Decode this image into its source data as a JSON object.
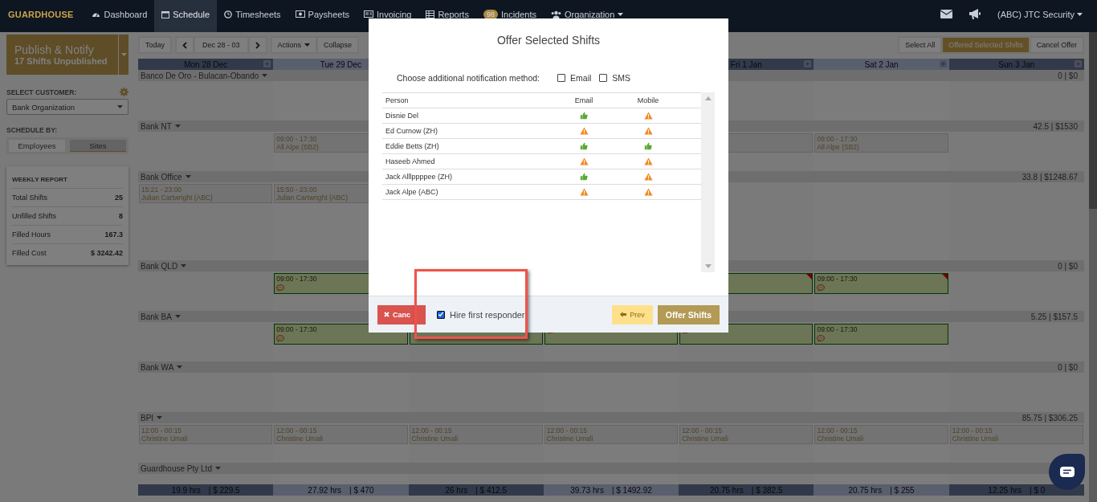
{
  "nav": {
    "logo": "GUARDHOUSE",
    "items": [
      {
        "label": "Dashboard",
        "selected": false
      },
      {
        "label": "Schedule",
        "selected": true
      },
      {
        "label": "Timesheets",
        "selected": false
      },
      {
        "label": "Paysheets",
        "selected": false
      },
      {
        "label": "Invoicing",
        "selected": false
      },
      {
        "label": "Reports",
        "selected": false
      },
      {
        "label": "Incidents",
        "selected": false,
        "badge": "98"
      },
      {
        "label": "Organization",
        "selected": false,
        "dropdown": true
      }
    ],
    "account": "(ABC) JTC Security"
  },
  "sidebar": {
    "publish": {
      "title": "Publish & Notify",
      "subtitle": "17 Shifts Unpublished"
    },
    "customer_label": "SELECT CUSTOMER:",
    "customer": "Bank Organization",
    "schedule_by_label": "SCHEDULE BY:",
    "schedule_by": [
      {
        "label": "Employees",
        "selected": false
      },
      {
        "label": "Sites",
        "selected": true
      }
    ],
    "report": {
      "title": "WEEKLY REPORT",
      "rows": [
        {
          "label": "Total Shifts",
          "value": "25"
        },
        {
          "label": "Unfilled Shifts",
          "value": "8"
        },
        {
          "label": "Filled Hours",
          "value": "167.3"
        },
        {
          "label": "Filled Cost",
          "value": "$ 3242.42"
        }
      ]
    }
  },
  "toolbar": {
    "today": "Today",
    "range": "Dec 28 - 03",
    "actions": "Actions",
    "collapse": "Collapse",
    "right": [
      {
        "label": "Select All",
        "selected": false
      },
      {
        "label": "Offered Selected Shifts",
        "selected": true
      },
      {
        "label": "Cancel Offer",
        "selected": false
      }
    ]
  },
  "days_before_dialog": [
    "Mon 28 Dec",
    "Tue 29 Dec"
  ],
  "days_after_dialog": [
    "Fri 1 Jan",
    "Sat 2 Jan",
    "Sun 3 Jan"
  ],
  "sites": [
    {
      "name": "Banco De Oro - Bulacan-Obando",
      "total": "0 | $0",
      "cells": [
        null,
        null,
        null,
        null,
        null,
        null,
        null
      ]
    },
    {
      "name": "Bank NT",
      "total": "42.5 | $1530",
      "cells": [
        null,
        {
          "kind": "draft",
          "time": "09:00 - 17:30",
          "name": "All Alpe (SB2)"
        },
        null,
        null,
        {
          "kind": "draft"
        },
        {
          "kind": "draft",
          "time": "09:00 - 17:30",
          "name": "All Alpe (SB2)"
        },
        null
      ]
    },
    {
      "name": "Bank Office",
      "total": "33.8 | $1248.67",
      "cells": [
        {
          "kind": "draft",
          "time": "15:21 - 23:00",
          "name": "Julian Cartwright (ABC)"
        },
        {
          "kind": "draft",
          "time": "15:50 - 23:00",
          "name": "Julian Cartwright (ABC)"
        },
        null,
        null,
        null,
        null,
        null
      ]
    },
    {
      "name": "Bank QLD",
      "total": "0 | $0",
      "cells": [
        null,
        {
          "kind": "offered",
          "time": "09:00 - 17:30",
          "comment": true
        },
        null,
        null,
        {
          "kind": "offered",
          "flagged": true
        },
        {
          "kind": "offered",
          "time": "09:00 - 17:30",
          "comment": true,
          "flagged": true
        },
        null
      ]
    },
    {
      "name": "Bank BA",
      "total": "5.25 | $157.5",
      "cells": [
        null,
        {
          "kind": "offered",
          "time": "09:00 - 17:30",
          "comment": true
        },
        {
          "kind": "offered",
          "comment": true
        },
        {
          "kind": "offered",
          "comment": true
        },
        {
          "kind": "offered",
          "comment": true
        },
        {
          "kind": "offered",
          "time": "09:00 - 17:30",
          "comment": true
        },
        null
      ]
    },
    {
      "name": "Bank WA",
      "total": "0 | $0",
      "cells": [
        null,
        null,
        null,
        null,
        null,
        null,
        null
      ]
    },
    {
      "name": "BPI",
      "total": "85.75 | $306.25",
      "cells": [
        {
          "kind": "draft",
          "time": "12:00 - 00:15",
          "name": "Christine Umali"
        },
        {
          "kind": "draft",
          "time": "12:00 - 00:15",
          "name": "Christine Umali"
        },
        {
          "kind": "draft",
          "time": "12:00 - 00:15",
          "name": "Christine Umali"
        },
        {
          "kind": "draft",
          "time": "12:00 - 00:15",
          "name": "Christine Umali"
        },
        {
          "kind": "draft",
          "time": "12:00 - 00:15",
          "name": "Christine Umali"
        },
        {
          "kind": "draft",
          "time": "12:00 - 00:15",
          "name": "Christine Umali"
        },
        {
          "kind": "draft",
          "time": "12:00 - 00:15",
          "name": "Christine Umali"
        }
      ]
    },
    {
      "name": "Guardhouse Pty Ltd",
      "cells": [
        null,
        null,
        null,
        null,
        null,
        null,
        null
      ]
    }
  ],
  "totals": [
    {
      "hours": "19.9 hrs",
      "cost": "| $ 229.5"
    },
    {
      "hours": "27.92 hrs",
      "cost": "| $ 470"
    },
    {
      "hours": "26 hrs",
      "cost": "| $ 412.5"
    },
    {
      "hours": "39.73 hrs",
      "cost": "| $ 1492.92"
    },
    {
      "hours": "20.75 hrs",
      "cost": "| $ 382.5"
    },
    {
      "hours": "20.75 hrs",
      "cost": "| $ 255"
    },
    {
      "hours": "12.25 hrs",
      "cost": "| $ 0"
    }
  ],
  "modal": {
    "title": "Offer Selected Shifts",
    "notify_label": "Choose additional notification method:",
    "notify_options": [
      {
        "label": "Email",
        "checked": false
      },
      {
        "label": "SMS",
        "checked": false
      }
    ],
    "columns": [
      "Person",
      "Email",
      "Mobile"
    ],
    "people": [
      {
        "name": "Disnie Del",
        "email_ok": true,
        "mobile_ok": false
      },
      {
        "name": "Ed Curnow (ZH)",
        "email_ok": false,
        "mobile_ok": false
      },
      {
        "name": "Eddie Betts (ZH)",
        "email_ok": true,
        "mobile_ok": true
      },
      {
        "name": "Haseeb Ahmed",
        "email_ok": false,
        "mobile_ok": false
      },
      {
        "name": "Jack Alllppppee (ZH)",
        "email_ok": true,
        "mobile_ok": false
      },
      {
        "name": "Jack Alpe (ABC)",
        "email_ok": false,
        "mobile_ok": false
      }
    ],
    "hire_first": {
      "label": "Hire first responder",
      "checked": true
    },
    "cancel": "Canc",
    "prev": "Prev",
    "offer": "Offer Shifts"
  }
}
